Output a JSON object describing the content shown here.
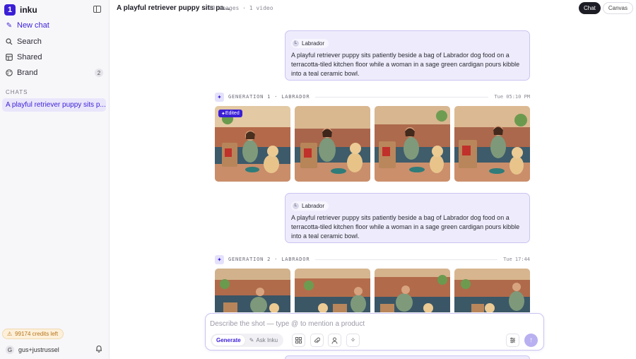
{
  "app": {
    "name": "inku",
    "logo_glyph": "1"
  },
  "sidebar": {
    "nav": [
      {
        "label": "New chat",
        "icon": "pencil-square-icon"
      },
      {
        "label": "Search",
        "icon": "search-icon"
      },
      {
        "label": "Shared",
        "icon": "shared-icon"
      },
      {
        "label": "Brand",
        "icon": "palette-icon",
        "badge": "2"
      }
    ],
    "chats_label": "CHATS",
    "chats": [
      {
        "title": "A playful retriever puppy sits p..."
      }
    ],
    "credits": "99174 credits left",
    "user": {
      "initial": "G",
      "name": "gus+justrussel"
    }
  },
  "header": {
    "title": "A playful retriever puppy sits pa...",
    "meta": "20 images · 1 video",
    "toggle": {
      "chat": "Chat",
      "canvas": "Canvas"
    }
  },
  "thread": {
    "prompts": [
      {
        "chip_initial": "L",
        "chip_label": "Labrador",
        "text": "A playful retriever puppy sits patiently beside a bag of Labrador dog food on a terracotta-tiled kitchen floor while a woman in a sage green cardigan pours kibble into a teal ceramic bowl."
      },
      {
        "chip_initial": "L",
        "chip_label": "Labrador",
        "text": "A playful retriever puppy sits patiently beside a bag of Labrador dog food on a terracotta-tiled kitchen floor while a woman in a sage green cardigan pours kibble into a teal ceramic bowl."
      }
    ],
    "generations": [
      {
        "label": "GENERATION 1 · LABRADOR",
        "time": "Tue 05:10 PM",
        "edited_badge": "Edited"
      },
      {
        "label": "GENERATION 2 · LABRADOR",
        "time": "Tue 17:44"
      }
    ]
  },
  "composer": {
    "placeholder": "Describe the shot — type @ to mention a product",
    "modes": {
      "generate": "Generate",
      "ask": "Ask Inku"
    }
  },
  "colors": {
    "accent": "#3b1fd6",
    "prompt_bg": "#eeecfc",
    "credits_text": "#b5741a"
  }
}
